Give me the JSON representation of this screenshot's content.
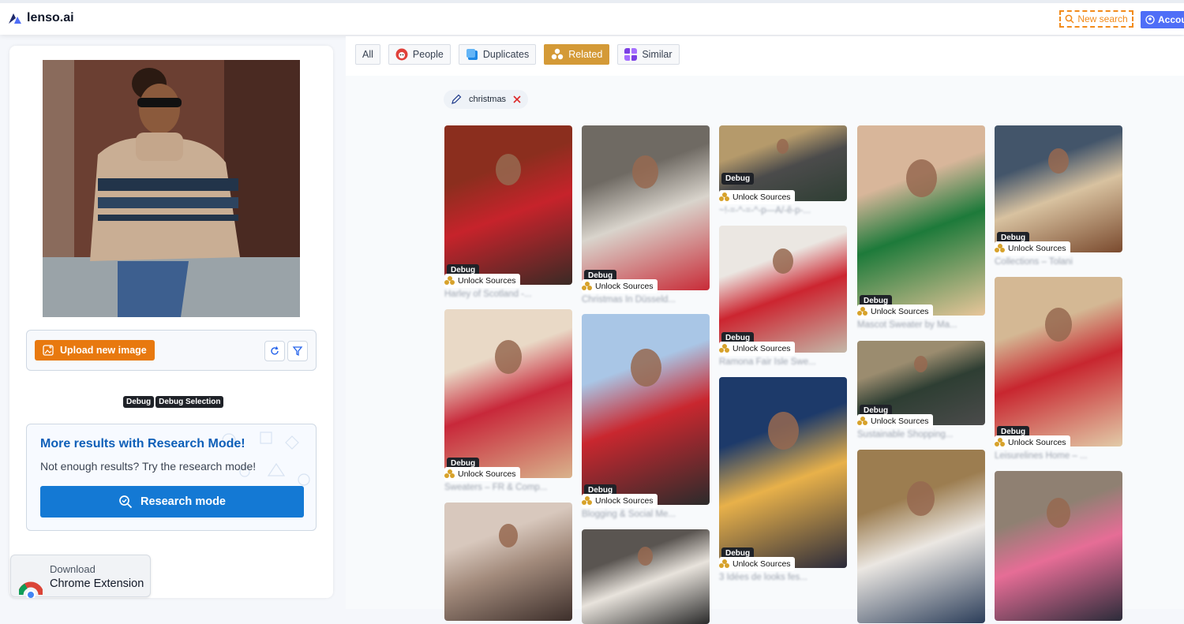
{
  "header": {
    "logo_text": "lenso.ai",
    "new_search_label": "New search",
    "account_label": "Accou"
  },
  "left": {
    "upload_label": "Upload new image",
    "debug_tags": [
      "Debug",
      "Debug Selection"
    ],
    "research": {
      "title": "More results with Research Mode!",
      "subtitle": "Not enough results? Try the research mode!",
      "button": "Research mode"
    },
    "chrome": {
      "line1": "Download",
      "line2": "Chrome Extension"
    }
  },
  "tabs": [
    {
      "label": "All",
      "icon": "none",
      "active": false
    },
    {
      "label": "People",
      "icon": "people-icon",
      "active": false
    },
    {
      "label": "Duplicates",
      "icon": "duplicates-icon",
      "active": false
    },
    {
      "label": "Related",
      "icon": "related-icon",
      "active": true
    },
    {
      "label": "Similar",
      "icon": "similar-icon",
      "active": false
    }
  ],
  "filter_chip": {
    "label": "christmas"
  },
  "results": {
    "debug_label": "Debug",
    "unlock_label": "Unlock Sources",
    "items": [
      {
        "caption": "Harley of Scotland -..."
      },
      {
        "caption": "Sweaters – FR & Comp..."
      },
      {
        "caption": ""
      },
      {
        "caption": "Christmas In Düsseld..."
      },
      {
        "caption": "Blogging & Social Me..."
      },
      {
        "caption": ""
      },
      {
        "caption": "~!-=-^-=-^-p—Ä/-ê-p-..."
      },
      {
        "caption": "Ramona Fair Isle Swe..."
      },
      {
        "caption": "3 Idées de looks fes..."
      },
      {
        "caption": "Mascot Sweater by Ma..."
      },
      {
        "caption": "Sustainable Shopping..."
      },
      {
        "caption": ""
      },
      {
        "caption": "Collections – Tolani"
      },
      {
        "caption": "Leisurelines Home – ..."
      },
      {
        "caption": ""
      }
    ]
  },
  "colors": {
    "brand_orange": "#e8790f",
    "research_blue": "#1479d4",
    "related_gold": "#d49a37",
    "account_blue": "#4f6ef7"
  }
}
